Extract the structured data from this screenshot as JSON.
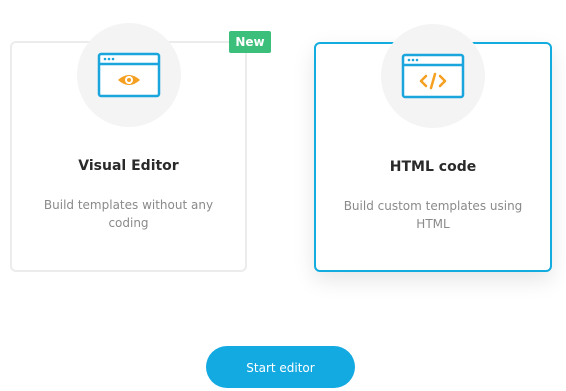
{
  "cards": [
    {
      "title": "Visual Editor",
      "description": "Build templates without any coding",
      "icon": "visual-editor-eye-icon",
      "badge": "New",
      "selected": false
    },
    {
      "title": "HTML code",
      "description": "Build custom templates using HTML",
      "icon": "html-code-icon",
      "selected": true
    }
  ],
  "actions": {
    "start_label": "Start editor"
  },
  "colors": {
    "accent": "#12acde",
    "badge": "#3cbf7a",
    "icon_orange": "#f5a020",
    "icon_blue": "#1aa6dd"
  }
}
